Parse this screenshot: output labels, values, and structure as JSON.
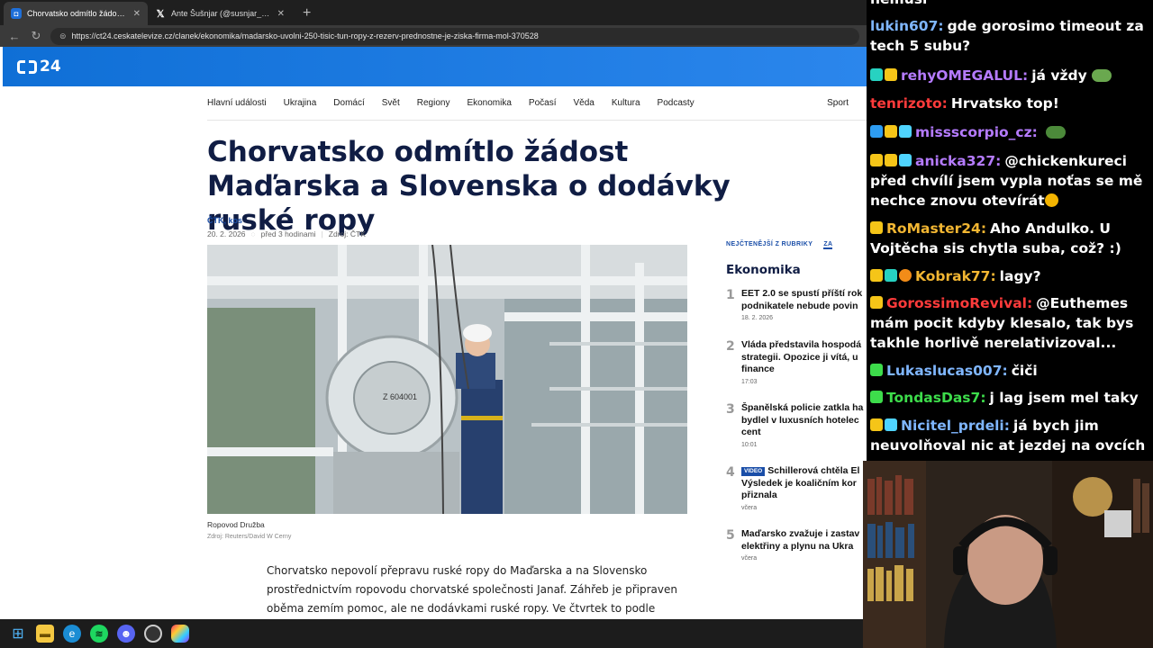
{
  "browser": {
    "tabs": [
      {
        "label": "Chorvatsko odmítlo žádost Maďar",
        "icon": "ct24-favicon",
        "active": true
      },
      {
        "label": "Ante Šušnjar (@susnjar_a) / X",
        "icon": "x-favicon",
        "active": false
      }
    ],
    "url": "https://ct24.ceskatelevize.cz/clanek/ekonomika/madarsko-uvolni-250-tisic-tun-ropy-z-rezerv-prednostne-je-ziska-firma-mol-370528"
  },
  "site": {
    "logo_text": "24",
    "nav": [
      "Hlavní události",
      "Ukrajina",
      "Domácí",
      "Svět",
      "Regiony",
      "Ekonomika",
      "Počasí",
      "Věda",
      "Kultura",
      "Podcasty"
    ],
    "nav_right": "Sport",
    "article": {
      "headline": "Chorvatsko odmítlo žádost Maďarska a Slovenska o dodávky ruské ropy",
      "authors": "ČTK, kos",
      "date": "20. 2. 2026",
      "relative_time": "před 3 hodinami",
      "source": "Zdroj: ČTK",
      "photo_label": "Z 604001",
      "caption": "Ropovod Družba",
      "credit": "Zdroj: Reuters/David W Cerny",
      "body": "Chorvatsko nepovolí přepravu ruské ropy do Maďarska a na Slovensko prostřednictvím ropovodu chorvatské společnosti Janaf. Záhřeb je připraven oběma zemím pomoc, ale ne dodávkami ruské ropy. Ve čtvrtek to podle webu"
    },
    "sidebar": {
      "tab_label": "NEJČTENĚJŠÍ Z RUBRIKY",
      "tab_label_2": "ZA",
      "title": "Ekonomika",
      "items": [
        {
          "num": "1",
          "lines": [
            "EET 2.0 se spustí příští rok",
            "podnikatele nebude povin"
          ],
          "date": "18. 2. 2026",
          "badge": ""
        },
        {
          "num": "2",
          "lines": [
            "Vláda představila hospodá",
            "strategii. Opozice ji vítá, u",
            "finance"
          ],
          "date": "17:03",
          "badge": ""
        },
        {
          "num": "3",
          "lines": [
            "Španělská policie zatkla ha",
            "bydlel v luxusních hotelec",
            "cent"
          ],
          "date": "10:01",
          "badge": ""
        },
        {
          "num": "4",
          "lines": [
            "Schillerová chtěla El",
            "Výsledek je koaličním kor",
            "přiznala"
          ],
          "date": "včera",
          "badge": "VIDEO"
        },
        {
          "num": "5",
          "lines": [
            "Maďarsko zvažuje i zastav",
            "elektřiny a plynu na Ukra"
          ],
          "date": "včera",
          "badge": ""
        }
      ]
    }
  },
  "chat": {
    "messages": [
      {
        "user": "",
        "user_color": "#ffffff",
        "badges": [],
        "lines": [
          "nemusí"
        ]
      },
      {
        "user": "lukin607:",
        "user_color": "#7fb6ff",
        "badges": [],
        "lines": [
          "gde gorosimo timeout za",
          "tech 5 subu?"
        ]
      },
      {
        "user": "rehyOMEGALUL:",
        "user_color": "#b57bff",
        "badges": [
          "b-teal",
          "b-gold"
        ],
        "lines": [
          "já vždy"
        ],
        "emote": "e-frog"
      },
      {
        "user": "tenrizoto:",
        "user_color": "#ff3b3b",
        "badges": [],
        "lines": [
          "Hrvatsko top!"
        ]
      },
      {
        "user": "missscorpio_cz:",
        "user_color": "#b57bff",
        "badges": [
          "b-blue",
          "b-gold",
          "b-cyan"
        ],
        "lines": [
          ""
        ],
        "emote": "e-fish"
      },
      {
        "user": "anicka327:",
        "user_color": "#b57bff",
        "badges": [
          "b-gold",
          "b-gold",
          "b-cyan"
        ],
        "lines": [
          "@chickenkureci",
          "před chvílí jsem vypla noťas se mě",
          "nechce znovu otevírát"
        ],
        "emote": "e-cry"
      },
      {
        "user": "RoMaster24:",
        "user_color": "#f2b632",
        "badges": [
          "b-gold"
        ],
        "lines": [
          "Aho Andulko. U",
          "Vojtěcha sis chytla suba, což? :)"
        ]
      },
      {
        "user": "Kobrak77:",
        "user_color": "#f2b632",
        "badges": [
          "b-gold",
          "b-teal",
          "b-orange"
        ],
        "lines": [
          "lagy?"
        ]
      },
      {
        "user": "GorossimoRevival:",
        "user_color": "#ff3b3b",
        "badges": [
          "b-gold"
        ],
        "lines": [
          "@Euthemes",
          "mám pocit kdyby klesalo, tak bys",
          "takhle horlivě nerelativizoval..."
        ]
      },
      {
        "user": "Lukaslucas007:",
        "user_color": "#7fb6ff",
        "badges": [
          "b-green"
        ],
        "lines": [
          "čiči"
        ]
      },
      {
        "user": "TondasDas7:",
        "user_color": "#3ddc4b",
        "badges": [
          "b-green"
        ],
        "lines": [
          "j lag jsem mel taky"
        ]
      },
      {
        "user": "Nicitel_prdeli:",
        "user_color": "#7fb6ff",
        "badges": [
          "b-gold",
          "b-cyan"
        ],
        "lines": [
          "já bych jim",
          "neuvolňoval nic at jezdej na ovcích"
        ]
      }
    ]
  },
  "taskbar": {
    "icons": [
      "windows-start-icon",
      "file-explorer-icon",
      "edge-icon",
      "spotify-icon",
      "discord-icon",
      "obs-icon",
      "copilot-icon"
    ]
  },
  "colors": {
    "ct_blue": "#1e6fd9",
    "headline_navy": "#101d44"
  }
}
